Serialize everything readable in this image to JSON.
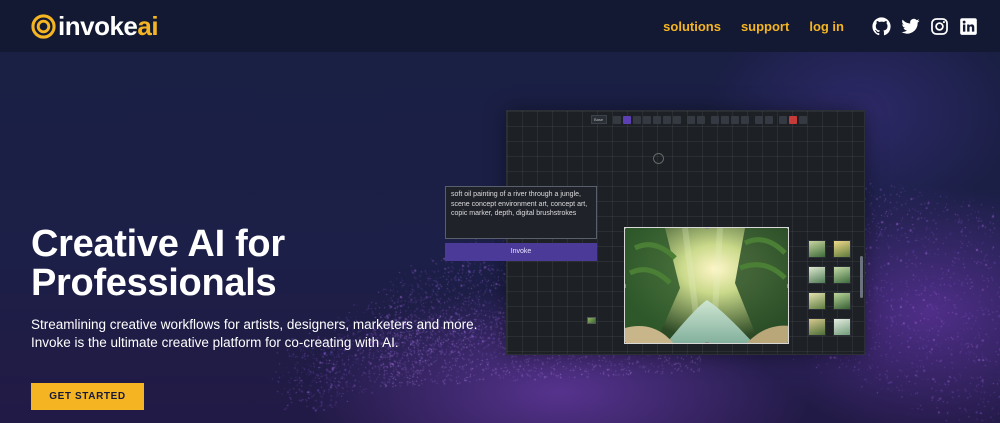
{
  "brand": {
    "name_white": "invoke",
    "name_accent": "ai",
    "accent_color": "#f5b522",
    "nav_bg": "#131933"
  },
  "nav": {
    "links": [
      "solutions",
      "support",
      "log in"
    ],
    "social_icons": [
      "github-icon",
      "twitter-icon",
      "instagram-icon",
      "linkedin-icon"
    ]
  },
  "hero": {
    "title_line1": "Creative AI for",
    "title_line2": "Professionals",
    "subtitle_line1": "Streamlining creative workflows for artists, designers, marketers and more.",
    "subtitle_line2": "Invoke is the ultimate creative platform for co-creating with AI.",
    "cta_label": "GET STARTED"
  },
  "app_preview": {
    "toolbar_select": "Base",
    "prompt_text": "soft oil painting of a river through a jungle, scene concept environment art, concept art, copic marker, depth, digital brushstrokes",
    "invoke_label": "Invoke"
  }
}
